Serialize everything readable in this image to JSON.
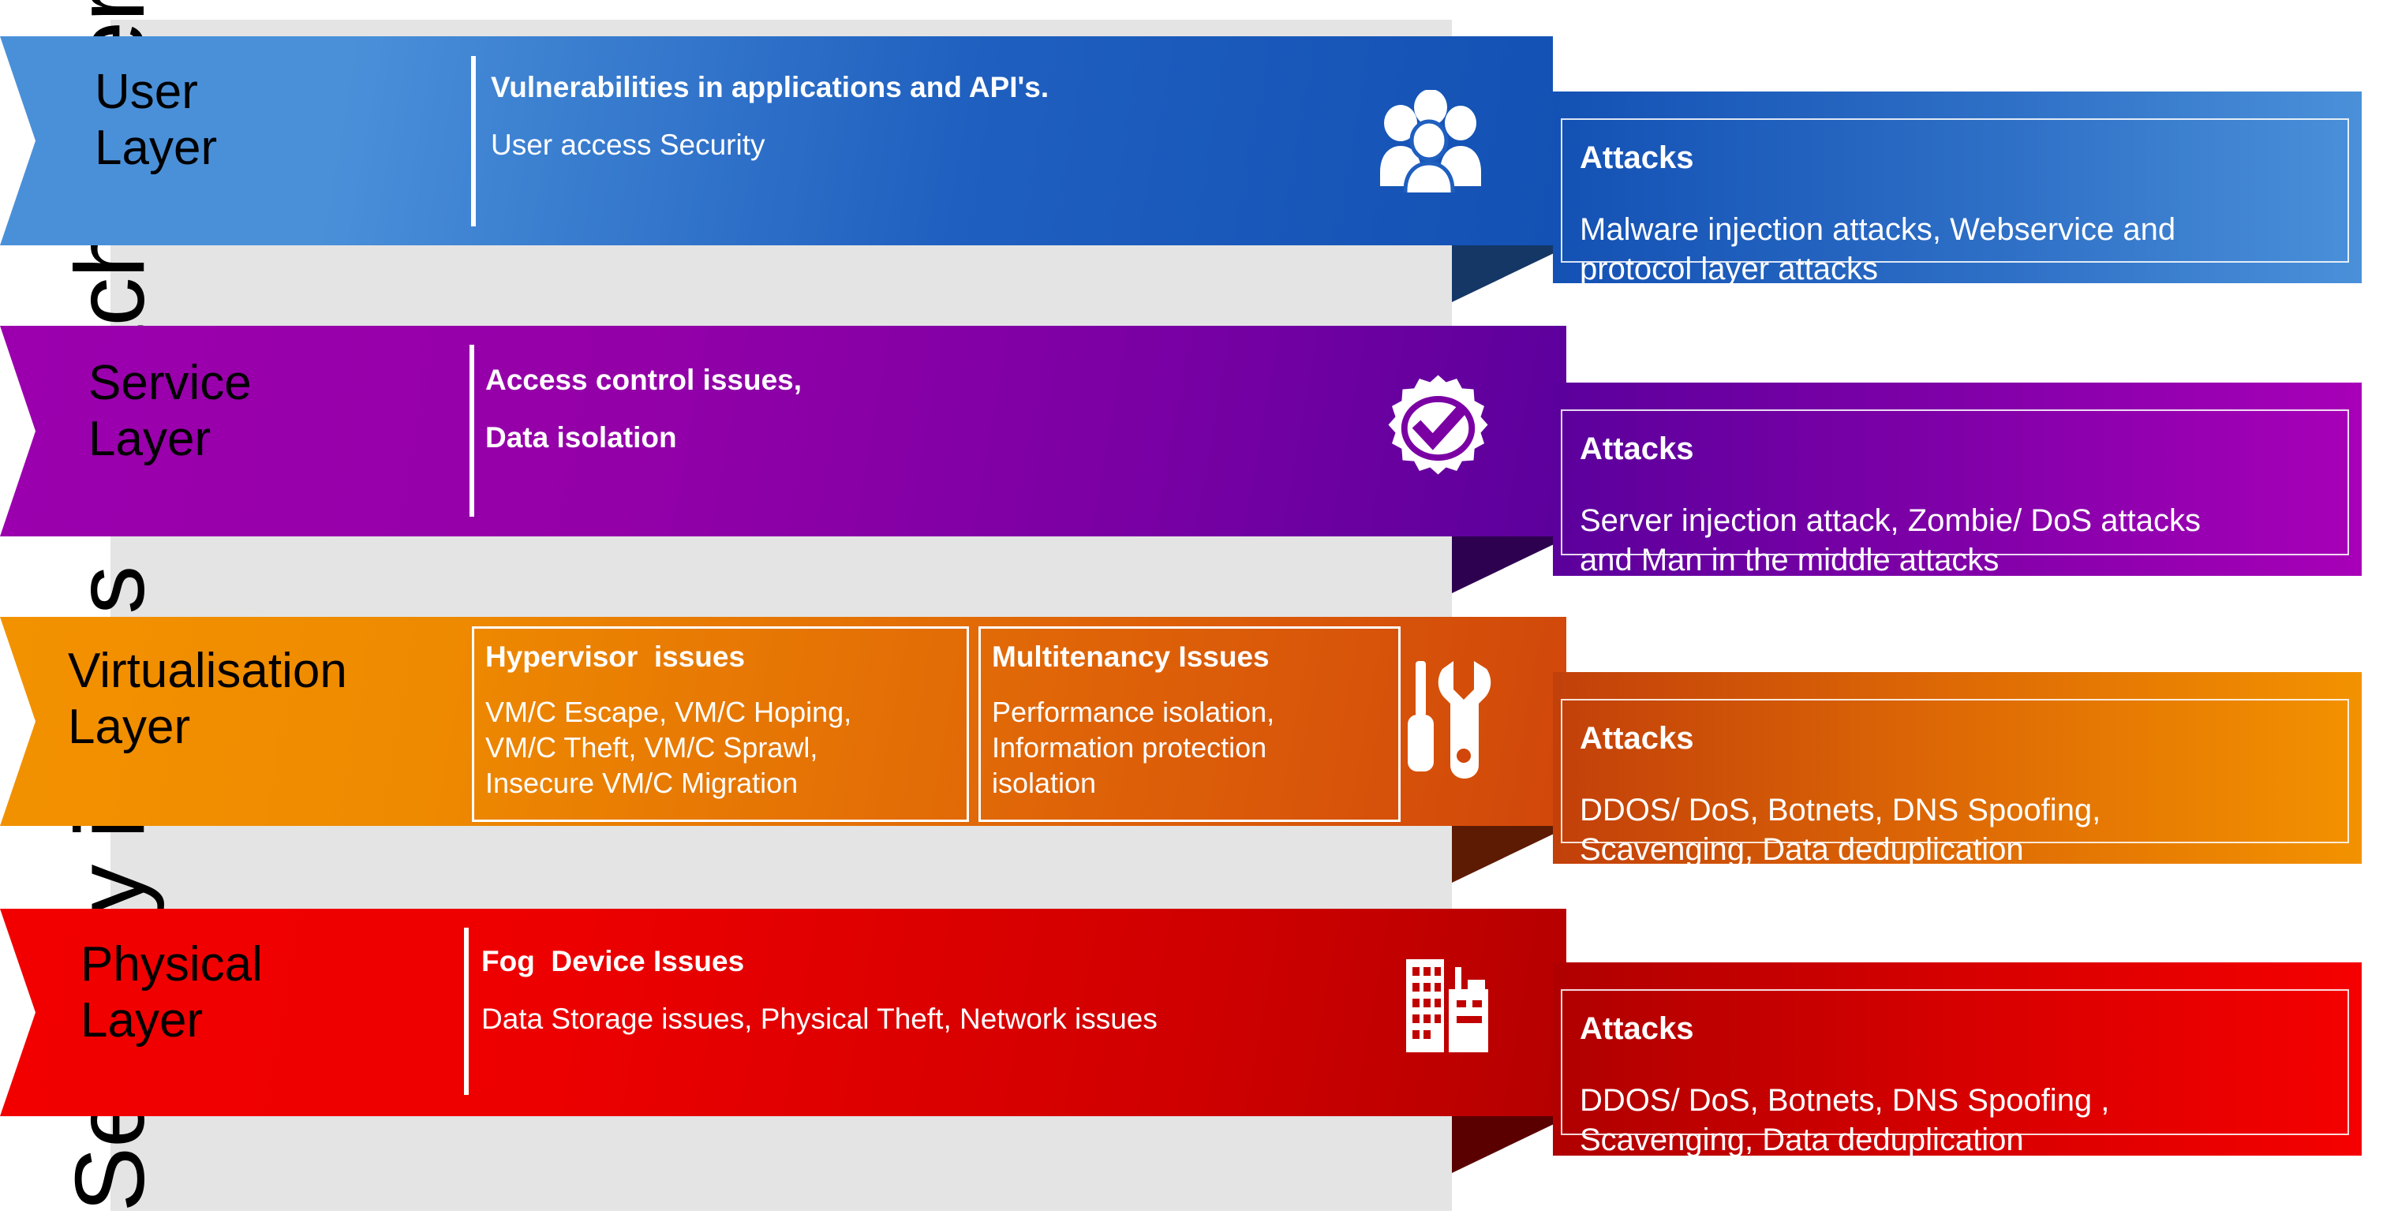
{
  "diagram": {
    "vertical_title": "Security issues at each layer",
    "background_color": "#e4e4e4"
  },
  "layers": [
    {
      "id": "user",
      "name": "User\nLayer",
      "accent": "#1F5FBF",
      "banner_gradient_from": "#4A90D9",
      "banner_gradient_to": "#1351B4",
      "callout_gradient_from": "#1351B4",
      "callout_gradient_to": "#4A90D9",
      "tail_color": "#143766",
      "icon": "users-icon",
      "issues_head": "Vulnerabilities in applications and API's.",
      "issues_body": "User access Security",
      "issues_body_bold": false,
      "attacks_title": "Attacks",
      "attacks_text": "Malware injection attacks, Webservice and\nprotocol layer attacks"
    },
    {
      "id": "service",
      "name": "Service\nLayer",
      "accent": "#9400A8",
      "banner_gradient_from": "#9C00AE",
      "banner_gradient_to": "#5B009C",
      "callout_gradient_from": "#5B009C",
      "callout_gradient_to": "#A800B8",
      "tail_color": "#2E0050",
      "icon": "verified-badge-icon",
      "issues_head": "Access control issues,",
      "issues_body": "Data isolation",
      "issues_body_bold": true,
      "attacks_title": "Attacks",
      "attacks_text": "Server injection attack, Zombie/ DoS attacks\nand Man in the middle attacks"
    },
    {
      "id": "virtualisation",
      "name": "Virtualisation\n Layer",
      "accent": "#E3780C",
      "banner_gradient_from": "#F39200",
      "banner_gradient_to": "#D1470B",
      "callout_gradient_from": "#C2400A",
      "callout_gradient_to": "#F39200",
      "tail_color": "#5E1B04",
      "icon": "tools-icon",
      "subboxes": [
        {
          "head": "Hypervisor  issues",
          "body": "VM/C Escape, VM/C Hoping,\nVM/C Theft,  VM/C Sprawl,\nInsecure VM/C Migration"
        },
        {
          "head": "Multitenancy Issues",
          "body": "Performance isolation,\nInformation protection\nisolation"
        }
      ],
      "attacks_title": "Attacks",
      "attacks_text": "DDOS/ DoS, Botnets, DNS Spoofing,\nScavenging, Data deduplication"
    },
    {
      "id": "physical",
      "name": "Physical\n Layer",
      "accent": "#E60000",
      "banner_gradient_from": "#F20000",
      "banner_gradient_to": "#B50000",
      "callout_gradient_from": "#B00000",
      "callout_gradient_to": "#F50000",
      "tail_color": "#5A0000",
      "icon": "buildings-icon",
      "issues_head": "Fog  Device Issues",
      "issues_body": "Data Storage issues, Physical Theft,  Network issues",
      "issues_body_bold": false,
      "attacks_title": "Attacks",
      "attacks_text": "DDOS/ DoS, Botnets, DNS Spoofing ,\nScavenging, Data deduplication"
    }
  ]
}
